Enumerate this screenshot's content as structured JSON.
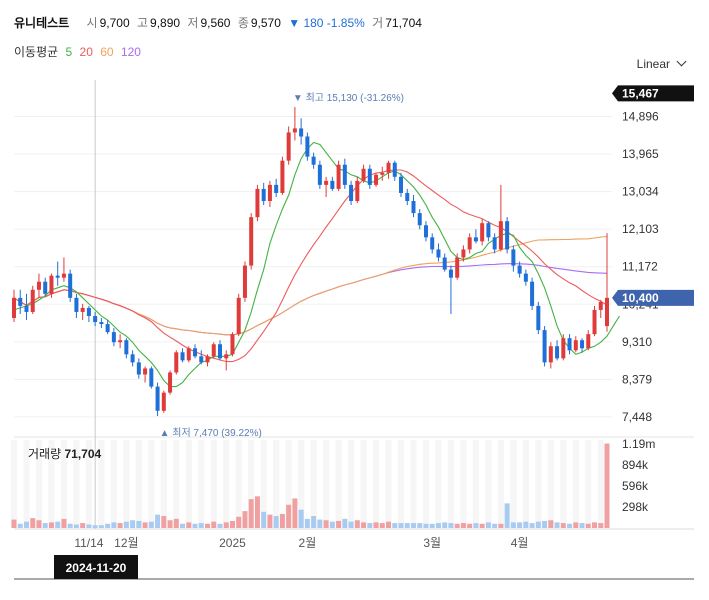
{
  "header": {
    "name": "유니테스트",
    "open_label": "시",
    "open": "9,700",
    "high_label": "고",
    "high": "9,890",
    "low_label": "저",
    "low": "9,560",
    "close_label": "종",
    "close": "9,570",
    "change": "▼ 180 -1.85%",
    "volume_label": "거",
    "volume": "71,704"
  },
  "ma_legend": {
    "title": "이동평균",
    "items": [
      {
        "label": "5",
        "color": "#43b343"
      },
      {
        "label": "20",
        "color": "#ee5b5b"
      },
      {
        "label": "60",
        "color": "#f0a25c"
      },
      {
        "label": "120",
        "color": "#a76ef0"
      }
    ]
  },
  "scale_mode": "Linear",
  "colors": {
    "up": "#e03b3b",
    "down": "#1e6fd8",
    "vol_up": "#f0a0a0",
    "vol_down": "#a9cbf2",
    "badge_dark": "#111111",
    "badge_blue": "#3f64ae",
    "annotation": "#5a7db8"
  },
  "chart_data": {
    "type": "candlestick",
    "y_ticks": [
      7448,
      8379,
      9310,
      10241,
      11172,
      12103,
      13034,
      13965,
      14896
    ],
    "y_tick_labels": [
      "7,448",
      "8,379",
      "9,310",
      "10,241",
      "11,172",
      "12,103",
      "13,034",
      "13,965",
      "14,896"
    ],
    "ylim": [
      7000,
      15800
    ],
    "badges": [
      {
        "value": 15467,
        "label": "15,467",
        "style": "dark"
      },
      {
        "value": 10400,
        "label": "10,400",
        "style": "blue"
      }
    ],
    "x_labels": [
      {
        "index": 12,
        "label": "11/14"
      },
      {
        "index": 18,
        "label": "12월"
      },
      {
        "index": 35,
        "label": "2025"
      },
      {
        "index": 47,
        "label": "2월"
      },
      {
        "index": 67,
        "label": "3월"
      },
      {
        "index": 81,
        "label": "4월"
      }
    ],
    "crosshair": {
      "index": 13,
      "label": "2024-11-20"
    },
    "max_annotation": {
      "index": 45,
      "value": 15130,
      "text": "▼ 최고 15,130 (-31.26%)"
    },
    "min_annotation": {
      "index": 23,
      "value": 7470,
      "text": "▲ 최저 7,470 (39.22%)"
    },
    "volume_title": "거래량",
    "volume_value": "71,704",
    "volume_ticks": [
      298000,
      596000,
      894000,
      1190000
    ],
    "volume_tick_labels": [
      "298k",
      "596k",
      "894k",
      "1.19m"
    ],
    "volume_max": 1250000,
    "ohlc": [
      [
        9900,
        10600,
        9800,
        10400
      ],
      [
        10400,
        10600,
        10000,
        10200
      ],
      [
        10200,
        10500,
        9850,
        10050
      ],
      [
        10050,
        10700,
        10000,
        10600
      ],
      [
        10600,
        11000,
        10400,
        10800
      ],
      [
        10800,
        10900,
        10450,
        10500
      ],
      [
        10500,
        11000,
        10400,
        10950
      ],
      [
        10950,
        11300,
        10700,
        10900
      ],
      [
        10900,
        11400,
        10800,
        11000
      ],
      [
        11000,
        11100,
        10300,
        10400
      ],
      [
        10400,
        10500,
        9900,
        10050
      ],
      [
        10050,
        10250,
        9850,
        10150
      ],
      [
        10150,
        10200,
        9800,
        9950
      ],
      [
        9950,
        10050,
        9700,
        9800
      ],
      [
        9800,
        9900,
        9650,
        9750
      ],
      [
        9750,
        9850,
        9500,
        9550
      ],
      [
        9550,
        9650,
        9200,
        9300
      ],
      [
        9300,
        9500,
        9150,
        9350
      ],
      [
        9350,
        9400,
        8900,
        9000
      ],
      [
        9000,
        9100,
        8700,
        8800
      ],
      [
        8800,
        8900,
        8400,
        8500
      ],
      [
        8500,
        8700,
        8300,
        8650
      ],
      [
        8650,
        8700,
        8150,
        8200
      ],
      [
        8200,
        8300,
        7470,
        7600
      ],
      [
        7600,
        8100,
        7550,
        8050
      ],
      [
        8050,
        8600,
        8000,
        8550
      ],
      [
        8550,
        9100,
        8500,
        9050
      ],
      [
        9050,
        9150,
        8800,
        8850
      ],
      [
        8850,
        9200,
        8800,
        9150
      ],
      [
        9150,
        9250,
        8900,
        8950
      ],
      [
        8950,
        9100,
        8750,
        8800
      ],
      [
        8800,
        9000,
        8700,
        8950
      ],
      [
        8950,
        9300,
        8900,
        9250
      ],
      [
        9250,
        9350,
        8850,
        8900
      ],
      [
        8900,
        9100,
        8600,
        9000
      ],
      [
        9000,
        9550,
        8950,
        9500
      ],
      [
        9500,
        10500,
        9450,
        10400
      ],
      [
        10400,
        11300,
        10300,
        11200
      ],
      [
        11200,
        12500,
        11100,
        12400
      ],
      [
        12400,
        13200,
        12300,
        13100
      ],
      [
        13100,
        13250,
        12700,
        12800
      ],
      [
        12800,
        13300,
        12650,
        13200
      ],
      [
        13200,
        13350,
        12900,
        13000
      ],
      [
        13000,
        13900,
        12950,
        13800
      ],
      [
        13800,
        14650,
        13700,
        14500
      ],
      [
        14500,
        15130,
        14300,
        14600
      ],
      [
        14600,
        14850,
        14200,
        14400
      ],
      [
        14400,
        14500,
        13800,
        13900
      ],
      [
        13900,
        14000,
        13600,
        13700
      ],
      [
        13700,
        13800,
        13100,
        13200
      ],
      [
        13200,
        13400,
        12900,
        13300
      ],
      [
        13300,
        13400,
        13050,
        13100
      ],
      [
        13100,
        13800,
        13050,
        13700
      ],
      [
        13700,
        13850,
        13100,
        13200
      ],
      [
        13200,
        13300,
        12700,
        12800
      ],
      [
        12800,
        13400,
        12750,
        13300
      ],
      [
        13300,
        13700,
        13250,
        13600
      ],
      [
        13600,
        13700,
        13100,
        13200
      ],
      [
        13200,
        13500,
        13150,
        13450
      ],
      [
        13450,
        13650,
        13300,
        13500
      ],
      [
        13500,
        13800,
        13350,
        13750
      ],
      [
        13750,
        13800,
        13300,
        13400
      ],
      [
        13400,
        13500,
        12900,
        13000
      ],
      [
        13000,
        13100,
        12700,
        12800
      ],
      [
        12800,
        12950,
        12400,
        12500
      ],
      [
        12500,
        12600,
        12100,
        12200
      ],
      [
        12200,
        12300,
        11800,
        11900
      ],
      [
        11900,
        12000,
        11500,
        11600
      ],
      [
        11600,
        11750,
        11300,
        11400
      ],
      [
        11400,
        11500,
        11050,
        11100
      ],
      [
        11100,
        11200,
        10000,
        10900
      ],
      [
        10900,
        11500,
        10850,
        11400
      ],
      [
        11400,
        11700,
        11300,
        11600
      ],
      [
        11600,
        12000,
        11500,
        11900
      ],
      [
        11900,
        12100,
        11750,
        11800
      ],
      [
        11800,
        12350,
        11700,
        12250
      ],
      [
        12250,
        12300,
        11800,
        11900
      ],
      [
        11900,
        12000,
        11500,
        11600
      ],
      [
        11600,
        13200,
        11550,
        12300
      ],
      [
        12300,
        12400,
        11500,
        11600
      ],
      [
        11600,
        11700,
        11050,
        11200
      ],
      [
        11200,
        11300,
        10900,
        11000
      ],
      [
        11000,
        11100,
        10700,
        10800
      ],
      [
        10800,
        10900,
        10100,
        10200
      ],
      [
        10200,
        10300,
        9500,
        9600
      ],
      [
        9600,
        9700,
        8700,
        8800
      ],
      [
        8800,
        9300,
        8650,
        9200
      ],
      [
        9200,
        9350,
        8850,
        8900
      ],
      [
        8900,
        9500,
        8850,
        9400
      ],
      [
        9400,
        9500,
        9000,
        9100
      ],
      [
        9100,
        9450,
        9050,
        9350
      ],
      [
        9350,
        9400,
        9050,
        9150
      ],
      [
        9150,
        9600,
        9100,
        9500
      ],
      [
        9500,
        10200,
        9450,
        10100
      ],
      [
        10100,
        10350,
        9900,
        10300
      ],
      [
        9700,
        12000,
        9560,
        10400
      ]
    ],
    "volume": [
      120000,
      60000,
      90000,
      140000,
      110000,
      70000,
      80000,
      90000,
      130000,
      60000,
      50000,
      70000,
      50000,
      40000,
      40000,
      60000,
      80000,
      70000,
      90000,
      110000,
      100000,
      80000,
      90000,
      190000,
      170000,
      110000,
      130000,
      60000,
      80000,
      60000,
      70000,
      60000,
      90000,
      60000,
      80000,
      100000,
      160000,
      240000,
      410000,
      450000,
      230000,
      190000,
      170000,
      200000,
      330000,
      420000,
      260000,
      130000,
      170000,
      120000,
      110000,
      90000,
      100000,
      130000,
      90000,
      110000,
      80000,
      70000,
      80000,
      70000,
      90000,
      70000,
      70000,
      70000,
      70000,
      70000,
      60000,
      60000,
      70000,
      80000,
      70000,
      60000,
      70000,
      60000,
      70000,
      60000,
      80000,
      60000,
      60000,
      350000,
      80000,
      80000,
      90000,
      70000,
      90000,
      100000,
      110000,
      80000,
      70000,
      60000,
      80000,
      70000,
      60000,
      80000,
      70000,
      1200000
    ],
    "ma5": [
      10100,
      10150,
      10200,
      10250,
      10350,
      10450,
      10600,
      10650,
      10700,
      10650,
      10550,
      10400,
      10250,
      10100,
      9950,
      9850,
      9700,
      9550,
      9450,
      9300,
      9100,
      8950,
      8800,
      8600,
      8350,
      8200,
      8200,
      8300,
      8500,
      8650,
      8800,
      8850,
      8950,
      8950,
      8950,
      9000,
      9300,
      9600,
      10050,
      10600,
      11100,
      11750,
      12200,
      12600,
      12950,
      13450,
      13850,
      14100,
      14250,
      14200,
      14000,
      13800,
      13600,
      13550,
      13450,
      13400,
      13300,
      13250,
      13300,
      13400,
      13500,
      13550,
      13450,
      13300,
      13150,
      12950,
      12700,
      12400,
      12150,
      11850,
      11550,
      11400,
      11350,
      11400,
      11500,
      11550,
      11750,
      11850,
      11950,
      12000,
      11950,
      11650,
      11450,
      11300,
      11000,
      10650,
      10200,
      9700,
      9350,
      9150,
      9000,
      9050,
      9150,
      9200,
      9300,
      9450,
      9700,
      9950
    ]
  }
}
